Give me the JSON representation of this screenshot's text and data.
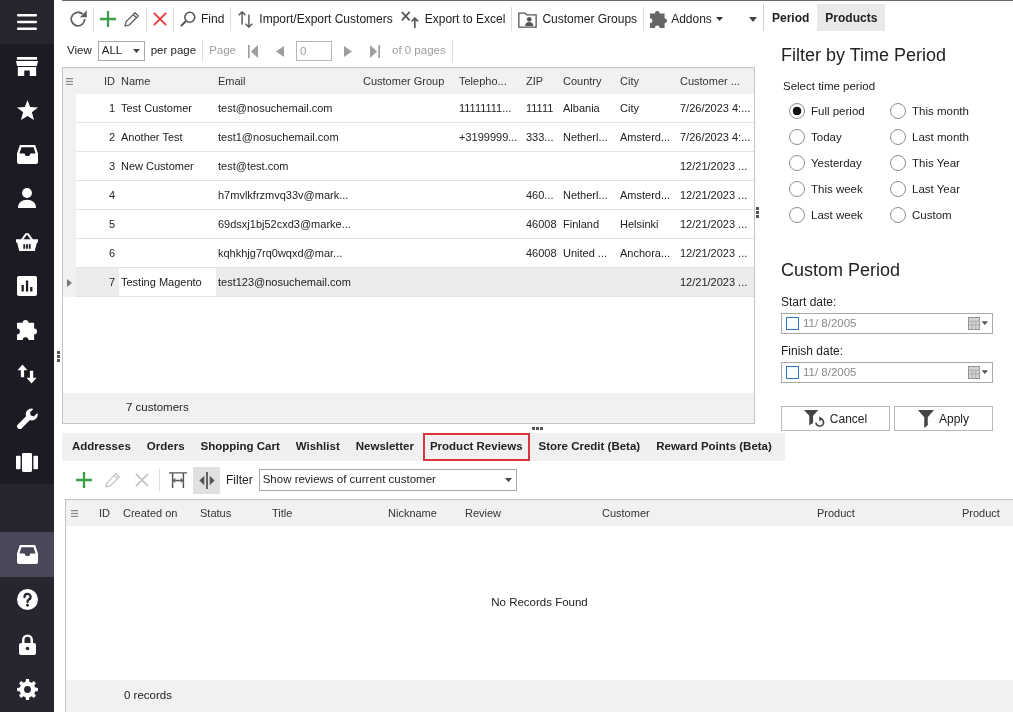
{
  "sidebar": {
    "items": [
      {
        "selected": false
      },
      {
        "selected": false
      },
      {
        "selected": false
      },
      {
        "selected": false
      },
      {
        "selected": false
      },
      {
        "selected": false
      },
      {
        "selected": false
      },
      {
        "selected": false
      },
      {
        "selected": false
      },
      {
        "selected": false
      }
    ],
    "bottom_items": [
      {
        "selected": true
      },
      {
        "selected": false
      },
      {
        "selected": false
      },
      {
        "selected": false
      }
    ]
  },
  "toolbar": {
    "groups": [
      [
        {
          "kind": "icon"
        }
      ],
      [
        {
          "kind": "icon"
        },
        {
          "kind": "icon"
        }
      ],
      [
        {
          "kind": "icon"
        }
      ],
      [
        {
          "kind": "labeled",
          "label": "Find"
        }
      ],
      [
        {
          "kind": "labeled",
          "label": "Import/Export Customers"
        },
        {
          "kind": "labeled",
          "label": "Export to Excel"
        }
      ],
      [
        {
          "kind": "labeled",
          "label": "Customer Groups"
        }
      ],
      [
        {
          "kind": "menu",
          "label": "Addons"
        },
        {
          "kind": "overflow"
        }
      ]
    ]
  },
  "pager": {
    "view_label": "View",
    "page_size": "ALL",
    "per_page_label": "per page",
    "page_label": "Page",
    "page_value": "0",
    "page_count": "of 0 pages",
    "disabled": true
  },
  "customers_grid": {
    "columns": [
      "ID",
      "Name",
      "Email",
      "Customer Group",
      "Telepho...",
      "ZIP",
      "Country",
      "City",
      "Customer ..."
    ],
    "rows": [
      {
        "selected": false,
        "id": "1",
        "name": "Test Customer",
        "email": "test@nosuchemail.com",
        "telephone": "11111111...",
        "zip": "11111",
        "country": "Albania",
        "city": "City",
        "column_9": "7/26/2023 4:..."
      },
      {
        "selected": false,
        "id": "2",
        "name": "Another Test",
        "email": "test1@nosuchemail.com",
        "telephone": "+3199999...",
        "zip": "333...",
        "country": "Netherl...",
        "city": "Amsterd...",
        "column_9": "7/26/2023 4:..."
      },
      {
        "selected": false,
        "id": "3",
        "name": "New Customer",
        "email": "test@test.com",
        "column_9": "12/21/2023 ..."
      },
      {
        "selected": false,
        "id": "4",
        "email": "h7mvlkfrzmvq33v@mark...",
        "zip": "460...",
        "country": "Netherl...",
        "city": "Amsterd...",
        "column_9": "12/21/2023 ..."
      },
      {
        "selected": false,
        "id": "5",
        "email": "69dsxj1bj52cxd3@marke...",
        "zip": "46008",
        "country": "Finland",
        "city": "Helsinki",
        "column_9": "12/21/2023 ..."
      },
      {
        "selected": false,
        "id": "6",
        "email": "kqhkhjg7rq0wqxd@mar...",
        "zip": "46008",
        "country": "United ...",
        "city": "Anchora...",
        "column_9": "12/21/2023 ..."
      },
      {
        "selected": true,
        "id": "7",
        "name": "Testing Magento",
        "email": "test123@nosuchemail.com",
        "column_9": "12/21/2023 ..."
      }
    ],
    "footer": "7 customers"
  },
  "side_panel": {
    "tabs": [
      {
        "label": "Period",
        "selected": true
      },
      {
        "label": "Products",
        "selected": false
      }
    ],
    "filter_title": "Filter by Time Period",
    "period_label": "Select time period",
    "periods": [
      {
        "label": "Full period",
        "selected": true
      },
      {
        "label": "This month",
        "selected": false
      },
      {
        "label": "Today",
        "selected": false
      },
      {
        "label": "Last month",
        "selected": false
      },
      {
        "label": "Yesterday",
        "selected": false
      },
      {
        "label": "This Year",
        "selected": false
      },
      {
        "label": "This week",
        "selected": false
      },
      {
        "label": "Last Year",
        "selected": false
      },
      {
        "label": "Last week",
        "selected": false
      },
      {
        "label": "Custom",
        "selected": false
      }
    ],
    "custom_title": "Custom Period",
    "start_date": {
      "label": "Start date:",
      "value": "11/ 8/2005",
      "checked": false
    },
    "finish_date": {
      "label": "Finish date:",
      "value": "11/ 8/2005",
      "checked": false
    },
    "buttons": [
      {
        "label": "Cancel"
      },
      {
        "label": "Apply"
      }
    ]
  },
  "detail_tabs": [
    {
      "label": "Addresses",
      "selected": false
    },
    {
      "label": "Orders",
      "selected": false
    },
    {
      "label": "Shopping Cart",
      "selected": false
    },
    {
      "label": "Wishlist",
      "selected": false
    },
    {
      "label": "Newsletter",
      "selected": false
    },
    {
      "label": "Product Reviews",
      "selected": true
    },
    {
      "label": "Store Credit (Beta)",
      "selected": false
    },
    {
      "label": "Reward Points (Beta)",
      "selected": false
    }
  ],
  "detail_toolbar": {
    "buttons": [
      {
        "disabled": false,
        "pressed": false
      },
      {
        "disabled": true,
        "pressed": false
      },
      {
        "disabled": true,
        "pressed": false
      },
      {
        "disabled": false,
        "pressed": false
      },
      {
        "disabled": false,
        "pressed": true
      }
    ],
    "filter_label": "Filter",
    "filter_value": "Show reviews of current customer"
  },
  "reviews_grid": {
    "columns": [
      "ID",
      "Created on",
      "Status",
      "Title",
      "Nickname",
      "Review",
      "Customer",
      "Product",
      "Product"
    ],
    "empty_message": "No Records Found",
    "footer": "0 records"
  }
}
